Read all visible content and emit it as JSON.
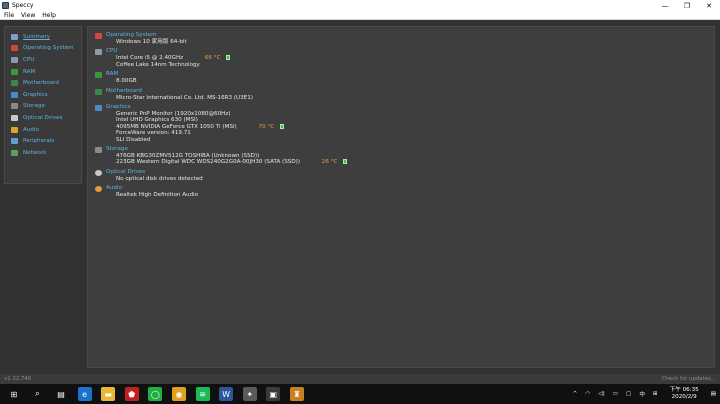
{
  "window": {
    "title": "Speccy",
    "minimize_glyph": "—",
    "maximize_glyph": "❐",
    "close_glyph": "✕"
  },
  "menu": [
    "File",
    "View",
    "Help"
  ],
  "sidebar": {
    "items": [
      {
        "label": "Summary",
        "icon": "summary-icon",
        "color": "#7aa0c8"
      },
      {
        "label": "Operating System",
        "icon": "windows-icon",
        "color": "#d04a3a"
      },
      {
        "label": "CPU",
        "icon": "cpu-icon",
        "color": "#8a9aa8"
      },
      {
        "label": "RAM",
        "icon": "ram-icon",
        "color": "#3a9a3a"
      },
      {
        "label": "Motherboard",
        "icon": "motherboard-icon",
        "color": "#3a8a4a"
      },
      {
        "label": "Graphics",
        "icon": "graphics-icon",
        "color": "#4a8ac8"
      },
      {
        "label": "Storage",
        "icon": "storage-icon",
        "color": "#8a8a8a"
      },
      {
        "label": "Optical Drives",
        "icon": "optical-drive-icon",
        "color": "#c8c8c8"
      },
      {
        "label": "Audio",
        "icon": "audio-icon",
        "color": "#e0a030"
      },
      {
        "label": "Peripherals",
        "icon": "peripherals-icon",
        "color": "#6a9ad0"
      },
      {
        "label": "Network",
        "icon": "network-icon",
        "color": "#5aa05a"
      }
    ]
  },
  "summary": {
    "os": {
      "title": "Operating System",
      "lines": [
        "Windows 10 家用版 64-bit"
      ]
    },
    "cpu": {
      "title": "CPU",
      "line1": "Intel Core i5 @ 2.40GHz",
      "temp": "66 °C",
      "line2": "Coffee Lake 14nm Technology"
    },
    "ram": {
      "title": "RAM",
      "lines": [
        "8.00GB"
      ]
    },
    "motherboard": {
      "title": "Motherboard",
      "lines": [
        "Micro-Star International Co. Ltd. MS-16R3 (U3E1)"
      ]
    },
    "graphics": {
      "title": "Graphics",
      "line1": "Generic PnP Monitor (1920x1080@60Hz)",
      "line2": "Intel UHD Graphics 630 (MSI)",
      "line3": "4095MB NVIDIA GeForce GTX 1050 Ti (MSI)",
      "temp": "70 °C",
      "line4": "ForceWare version: 419.71",
      "line5": "SLI Disabled"
    },
    "storage": {
      "title": "Storage",
      "line1": "476GB KBG30ZMV512G TOSHIBA (Unknown (SSD))",
      "line2": "223GB Western Digital WDC WDS240G2G0A-00JH30 (SATA (SSD))",
      "temp": "26 °C"
    },
    "optical": {
      "title": "Optical Drives",
      "lines": [
        "No optical disk drives detected"
      ]
    },
    "audio": {
      "title": "Audio",
      "lines": [
        "Realtek High Definition Audio"
      ]
    }
  },
  "status": {
    "version": "v1.32.740",
    "updates": "Check for updates..."
  },
  "taskbar": {
    "apps": [
      {
        "name": "start",
        "glyph": "⊞",
        "color": "#101010"
      },
      {
        "name": "search",
        "glyph": "⌕",
        "color": "#101010"
      },
      {
        "name": "task-view",
        "glyph": "▤",
        "color": "#101010"
      },
      {
        "name": "edge",
        "glyph": "e",
        "color": "#1a73c8"
      },
      {
        "name": "file-explorer",
        "glyph": "▬",
        "color": "#e8b830"
      },
      {
        "name": "msi",
        "glyph": "⬟",
        "color": "#c02020"
      },
      {
        "name": "line",
        "glyph": "◯",
        "color": "#20b040"
      },
      {
        "name": "chrome",
        "glyph": "◉",
        "color": "#e0a020"
      },
      {
        "name": "spotify",
        "glyph": "≋",
        "color": "#1db954"
      },
      {
        "name": "word",
        "glyph": "W",
        "color": "#2b579a"
      },
      {
        "name": "app-bird",
        "glyph": "✦",
        "color": "#5a5a5a"
      },
      {
        "name": "speccy",
        "glyph": "▣",
        "color": "#3a3a3a"
      },
      {
        "name": "app-figure",
        "glyph": "♜",
        "color": "#c88020"
      }
    ],
    "tray": {
      "chevron": "^",
      "wifi": "◠",
      "volume": "◁)",
      "battery": "▭",
      "notify": "▢",
      "lang": "中",
      "keyboard": "⊞",
      "time": "下午 06:35",
      "date": "2020/2/9",
      "action_center": "▤"
    }
  }
}
